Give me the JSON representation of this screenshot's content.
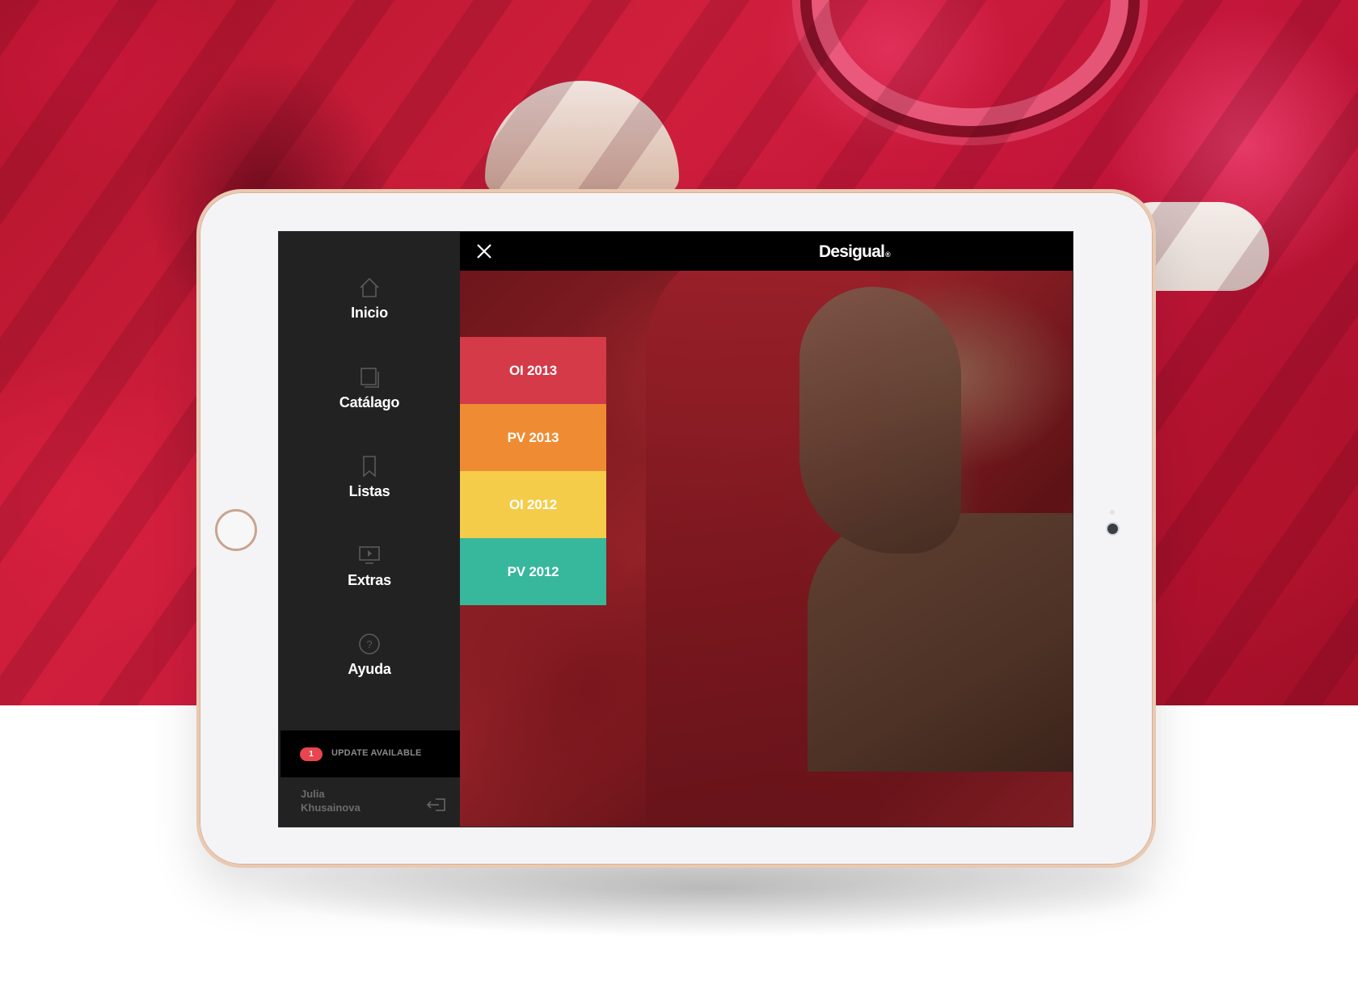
{
  "app": {
    "brand": "Desigual",
    "brand_mark": "®"
  },
  "sidebar": {
    "items": [
      {
        "label": "Inicio",
        "icon": "home-icon"
      },
      {
        "label": "Catálago",
        "icon": "catalog-icon"
      },
      {
        "label": "Listas",
        "icon": "bookmark-icon"
      },
      {
        "label": "Extras",
        "icon": "video-icon"
      },
      {
        "label": "Ayuda",
        "icon": "help-icon"
      }
    ],
    "update": {
      "count": "1",
      "label": "UPDATE AVAILABLE"
    },
    "user": {
      "first_name": "Julia",
      "last_name": "Khusainova"
    }
  },
  "seasons": [
    {
      "label": "OI 2013",
      "color": "#d43a48"
    },
    {
      "label": "PV 2013",
      "color": "#ef8c33"
    },
    {
      "label": "OI 2012",
      "color": "#f5cc4a"
    },
    {
      "label": "PV 2012",
      "color": "#37b79b"
    }
  ],
  "colors": {
    "sidebar_bg": "#222222",
    "topbar_bg": "#000000",
    "badge": "#e8454e"
  }
}
